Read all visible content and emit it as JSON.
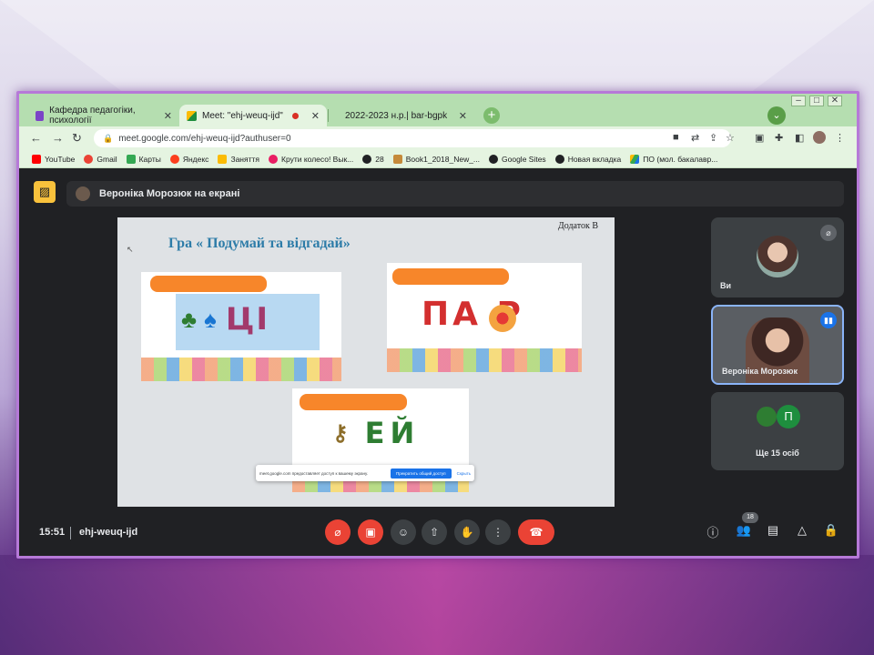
{
  "browser": {
    "tabs": [
      {
        "label": "Кафедра педагогіки, психології",
        "favicon_color": "#7b44c7"
      },
      {
        "label": "Meet: \"ehj-weuq-ijd\"",
        "favicon_color": "#1e8e3e"
      },
      {
        "label": "2022-2023 н.р.| bar-bgpk",
        "favicon_color": "#2e7d32"
      }
    ],
    "newtab_label": "+",
    "profile_initial": "✓",
    "url": "meet.google.com/ehj-weuq-ijd?authuser=0",
    "bookmarks": [
      {
        "label": "YouTube",
        "color": "#ff0000"
      },
      {
        "label": "Gmail",
        "color": "#ea4335"
      },
      {
        "label": "Карты",
        "color": "#34a853"
      },
      {
        "label": "Яндекс",
        "color": "#fc3f1d"
      },
      {
        "label": "Заняття",
        "color": "#fbbc04"
      },
      {
        "label": "Крути колесо! Вык...",
        "color": "#e91e63"
      },
      {
        "label": "28",
        "color": "#202124"
      },
      {
        "label": "Book1_2018_New_...",
        "color": "#c58a3a"
      },
      {
        "label": "Google Sites",
        "color": "#202124"
      },
      {
        "label": "Новая вкладка",
        "color": "#202124"
      },
      {
        "label": "ПО (мол. бакалавр...",
        "color": "#1a73e8"
      }
    ]
  },
  "meet": {
    "presenting_banner": "Вероніка Морозюк на екрані",
    "slide": {
      "title": "Гра « Подумай та відгадай»",
      "addendum": "Додаток В",
      "puzzle1_letters": "ЦІ",
      "puzzle2_letters": "ПА Р",
      "puzzle3_letters": "ЕЙ"
    },
    "share_notice": {
      "text": "meet.google.com предоставляет доступ к вашему экрану.",
      "stop_button": "Прекратить общий доступ",
      "hide_button": "Скрыть"
    },
    "participants": [
      {
        "name": "Ви"
      },
      {
        "name": "Вероніка Морозюк"
      }
    ],
    "more_initial": "П",
    "more_label": "Ще 15 осіб",
    "clock": "15:51",
    "meeting_code": "ehj-weuq-ijd",
    "participant_count": "18"
  },
  "icons": {
    "mic_off": "mic-off-icon",
    "cam_off": "camera-off-icon",
    "emoji": "emoji-icon",
    "present": "present-screen-icon",
    "hand": "raise-hand-icon",
    "more": "more-options-icon",
    "end": "end-call-icon"
  }
}
